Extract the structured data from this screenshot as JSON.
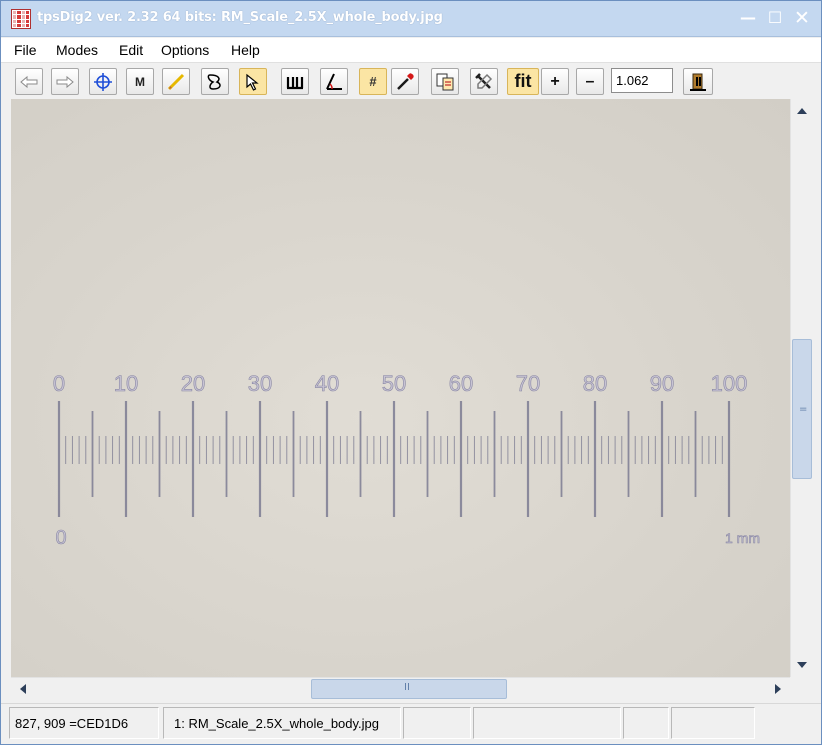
{
  "window": {
    "title": "tpsDig2 ver. 2.32 64 bits: RM_Scale_2.5X_whole_body.jpg",
    "controls": {
      "minimize": "—",
      "maximize": "☐",
      "close": "✕"
    }
  },
  "menu": {
    "file": "File",
    "modes": "Modes",
    "edit": "Edit",
    "options": "Options",
    "help": "Help"
  },
  "toolbar": {
    "tools": [
      {
        "name": "previous-image",
        "icon": "arrow-left-icon"
      },
      {
        "name": "next-image",
        "icon": "arrow-right-icon"
      },
      {
        "name": "landmark-mode",
        "icon": "crosshair-icon"
      },
      {
        "name": "measure-mode",
        "icon": "m-icon",
        "label": "M"
      },
      {
        "name": "draw-line",
        "icon": "pencil-line-icon"
      },
      {
        "name": "outline-mode",
        "icon": "curve-icon"
      },
      {
        "name": "select-mode",
        "icon": "pointer-icon",
        "active": true
      },
      {
        "name": "scale-mode",
        "icon": "ruler-icon"
      },
      {
        "name": "angle-mode",
        "icon": "angle-icon"
      },
      {
        "name": "number-landmarks",
        "icon": "hash-icon",
        "label": "#"
      },
      {
        "name": "color-picker",
        "icon": "dropper-icon"
      },
      {
        "name": "copy-image",
        "icon": "copy-icon"
      },
      {
        "name": "image-tools",
        "icon": "tools-icon"
      },
      {
        "name": "fit-image",
        "icon": "fit-icon",
        "label": "fit",
        "active": true
      },
      {
        "name": "zoom-in",
        "icon": "plus-icon",
        "label": "+"
      },
      {
        "name": "zoom-out",
        "icon": "minus-icon",
        "label": "–"
      },
      {
        "name": "exit",
        "icon": "exit-door-icon"
      }
    ],
    "zoom_value": "1.062"
  },
  "image": {
    "scale_labels": [
      "0",
      "10",
      "20",
      "30",
      "40",
      "50",
      "60",
      "70",
      "80",
      "90",
      "100"
    ],
    "scale_start_label": "0",
    "scale_unit_label": "1 mm"
  },
  "scrollbars": {
    "vertical_grip": "=",
    "horizontal_grip": "II"
  },
  "status": {
    "coords": "827, 909 =CED1D6",
    "file": "1: RM_Scale_2.5X_whole_body.jpg",
    "c3": "",
    "c4": "",
    "c5": "",
    "c6": ""
  },
  "colors": {
    "title_bar": "#c4d8f0",
    "image_background": "#d9d5cd",
    "scale_ink": "#6f6f8a",
    "active_tool": "#fbe5a4"
  }
}
